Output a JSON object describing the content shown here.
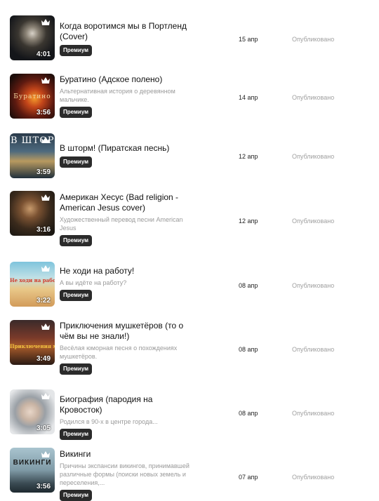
{
  "badge_label": "Премиум",
  "items": [
    {
      "title": "Когда воротимся мы в Портленд (Cover)",
      "description": "",
      "duration": "4:01",
      "date": "15 апр",
      "status": "Опубликовано",
      "art": "pirate-skull"
    },
    {
      "title": "Буратино (Адское полено)",
      "description": "Альтернативная история о деревянном мальчике.",
      "duration": "3:56",
      "date": "14 апр",
      "status": "Опубликовано",
      "art": "burning-log",
      "overtext": "Буратино"
    },
    {
      "title": "В шторм! (Пиратская песнь)",
      "description": "",
      "duration": "3:59",
      "date": "12 апр",
      "status": "Опубликовано",
      "art": "ship-storm",
      "overtext": "В ШТОРМ"
    },
    {
      "title": "Американ Хесус (Bad religion - American Jesus cover)",
      "description": "Художественный перевод песни American Jesus",
      "duration": "3:16",
      "date": "12 апр",
      "status": "Опубликовано",
      "art": "bearded-man"
    },
    {
      "title": "Не ходи на работу!",
      "description": "А вы идёте на работу?",
      "duration": "3:22",
      "date": "08 апр",
      "status": "Опубликовано",
      "art": "beach-hammock",
      "overtext": "Не ходи на работу"
    },
    {
      "title": "Приключения мушкетёров (то о чём вы не знали!)",
      "description": "Весёлая юморная песня о похождениях мушкетёров.",
      "duration": "3:49",
      "date": "08 апр",
      "status": "Опубликовано",
      "art": "musketeers",
      "overtext": "Приключения мушкетёров"
    },
    {
      "title": "Биография (пародия на Кровосток)",
      "description": "Родился в 90-х в центре города...",
      "duration": "3:05",
      "date": "08 апр",
      "status": "Опубликовано",
      "art": "glasses-man"
    },
    {
      "title": "Викинги",
      "description": "Причины экспансии викингов, принимавшей различные формы (поиски новых земель и переселения,...",
      "duration": "3:56",
      "date": "07 апр",
      "status": "Опубликовано",
      "art": "vikings",
      "overtext": "ВИКИНГИ"
    }
  ]
}
